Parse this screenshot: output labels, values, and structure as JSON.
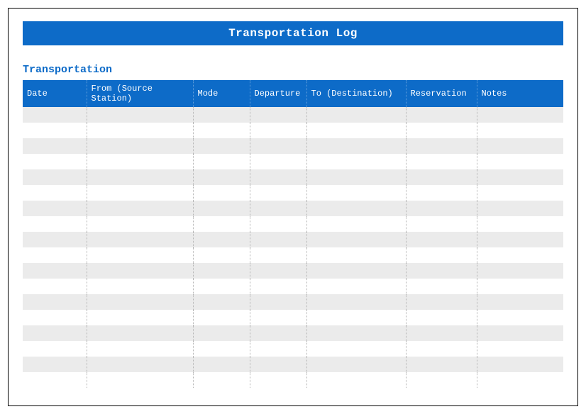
{
  "title": "Transportation Log",
  "section_heading": "Transportation",
  "columns": [
    {
      "key": "date",
      "label": "Date"
    },
    {
      "key": "from",
      "label": "From (Source Station)"
    },
    {
      "key": "mode",
      "label": "Mode"
    },
    {
      "key": "departure",
      "label": "Departure"
    },
    {
      "key": "to",
      "label": "To (Destination)"
    },
    {
      "key": "reservation",
      "label": "Reservation"
    },
    {
      "key": "notes",
      "label": "Notes"
    }
  ],
  "rows": [
    {
      "date": "",
      "from": "",
      "mode": "",
      "departure": "",
      "to": "",
      "reservation": "",
      "notes": ""
    },
    {
      "date": "",
      "from": "",
      "mode": "",
      "departure": "",
      "to": "",
      "reservation": "",
      "notes": ""
    },
    {
      "date": "",
      "from": "",
      "mode": "",
      "departure": "",
      "to": "",
      "reservation": "",
      "notes": ""
    },
    {
      "date": "",
      "from": "",
      "mode": "",
      "departure": "",
      "to": "",
      "reservation": "",
      "notes": ""
    },
    {
      "date": "",
      "from": "",
      "mode": "",
      "departure": "",
      "to": "",
      "reservation": "",
      "notes": ""
    },
    {
      "date": "",
      "from": "",
      "mode": "",
      "departure": "",
      "to": "",
      "reservation": "",
      "notes": ""
    },
    {
      "date": "",
      "from": "",
      "mode": "",
      "departure": "",
      "to": "",
      "reservation": "",
      "notes": ""
    },
    {
      "date": "",
      "from": "",
      "mode": "",
      "departure": "",
      "to": "",
      "reservation": "",
      "notes": ""
    },
    {
      "date": "",
      "from": "",
      "mode": "",
      "departure": "",
      "to": "",
      "reservation": "",
      "notes": ""
    },
    {
      "date": "",
      "from": "",
      "mode": "",
      "departure": "",
      "to": "",
      "reservation": "",
      "notes": ""
    },
    {
      "date": "",
      "from": "",
      "mode": "",
      "departure": "",
      "to": "",
      "reservation": "",
      "notes": ""
    },
    {
      "date": "",
      "from": "",
      "mode": "",
      "departure": "",
      "to": "",
      "reservation": "",
      "notes": ""
    },
    {
      "date": "",
      "from": "",
      "mode": "",
      "departure": "",
      "to": "",
      "reservation": "",
      "notes": ""
    },
    {
      "date": "",
      "from": "",
      "mode": "",
      "departure": "",
      "to": "",
      "reservation": "",
      "notes": ""
    },
    {
      "date": "",
      "from": "",
      "mode": "",
      "departure": "",
      "to": "",
      "reservation": "",
      "notes": ""
    },
    {
      "date": "",
      "from": "",
      "mode": "",
      "departure": "",
      "to": "",
      "reservation": "",
      "notes": ""
    },
    {
      "date": "",
      "from": "",
      "mode": "",
      "departure": "",
      "to": "",
      "reservation": "",
      "notes": ""
    },
    {
      "date": "",
      "from": "",
      "mode": "",
      "departure": "",
      "to": "",
      "reservation": "",
      "notes": ""
    }
  ]
}
